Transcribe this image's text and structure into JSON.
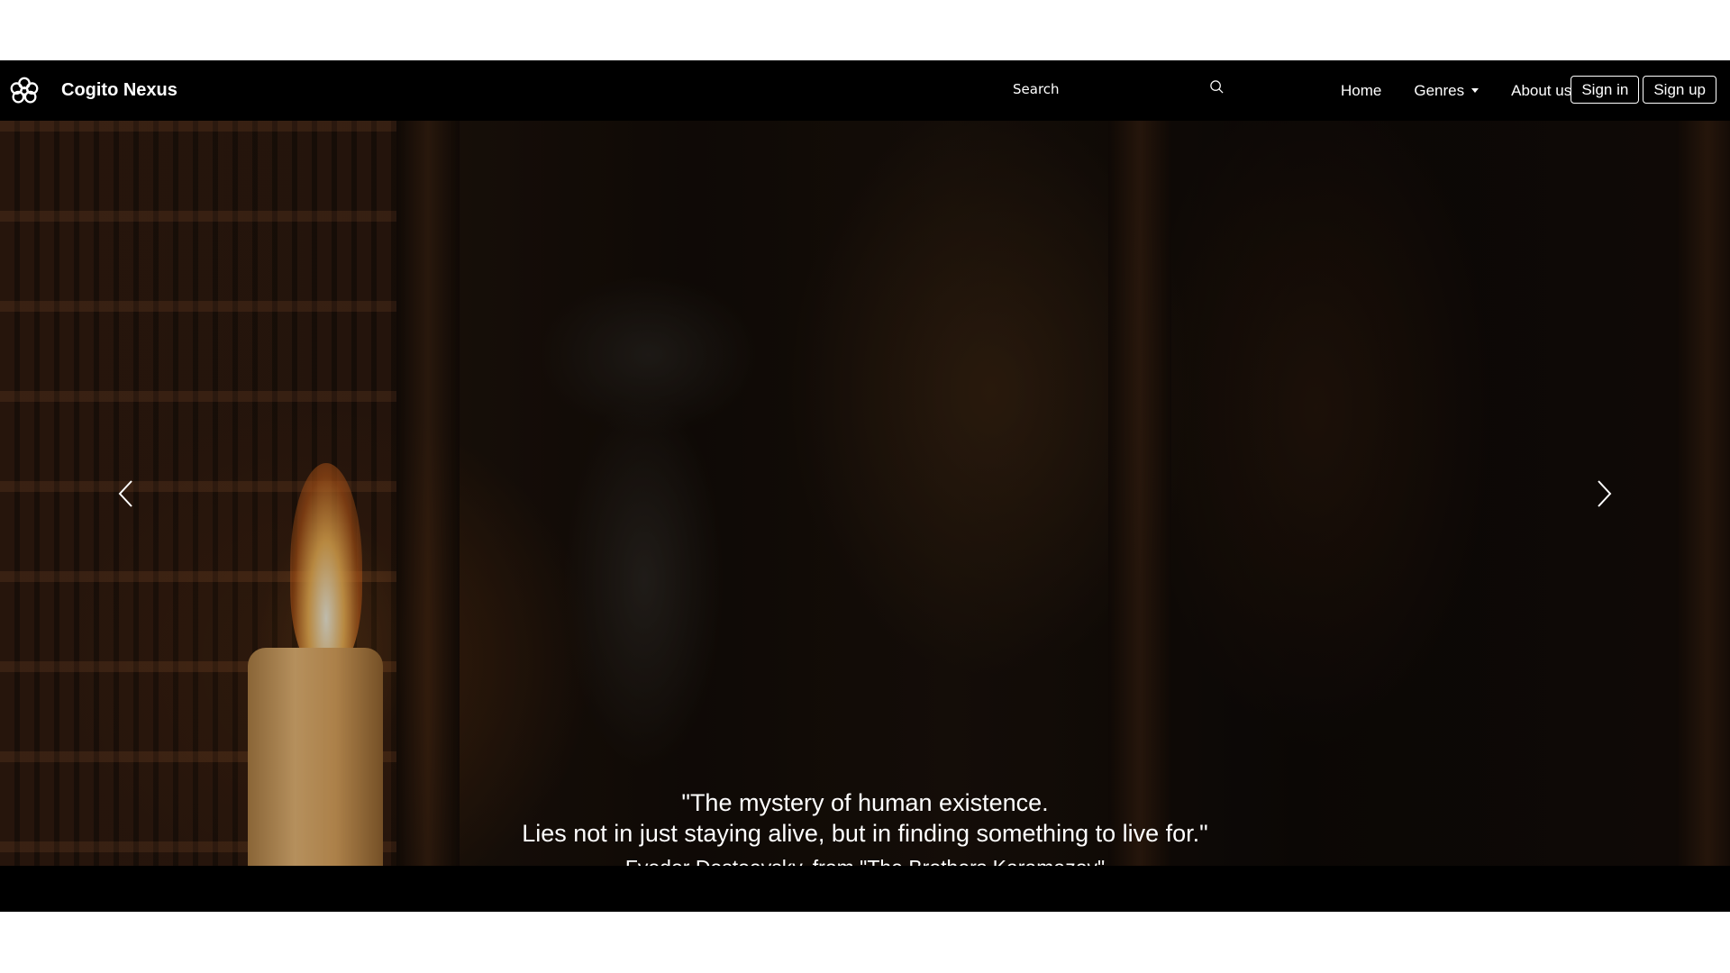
{
  "navbar": {
    "brand_name": "Cogito Nexus",
    "brand_icon": "knot-logo-icon",
    "search_placeholder": "Search",
    "links": [
      {
        "label": "Home"
      },
      {
        "label": "Genres"
      },
      {
        "label": "About us"
      }
    ],
    "sign_in_label": "Sign in",
    "sign_up_label": "Sign up"
  },
  "carousel": {
    "quote_line1": "\"The mystery of human existence.",
    "quote_line2": "Lies not in just staying alive, but in finding something to live for.\"",
    "attribution": "Fyodor Dostoevsky, from \"The Brothers Karamazov\"",
    "slide_count": 3,
    "active_slide": 1,
    "prev_icon": "chevron-left-icon",
    "next_icon": "chevron-right-icon"
  },
  "colors": {
    "background": "#000000",
    "text": "#ffffff",
    "page_margin": "#ffffff"
  }
}
